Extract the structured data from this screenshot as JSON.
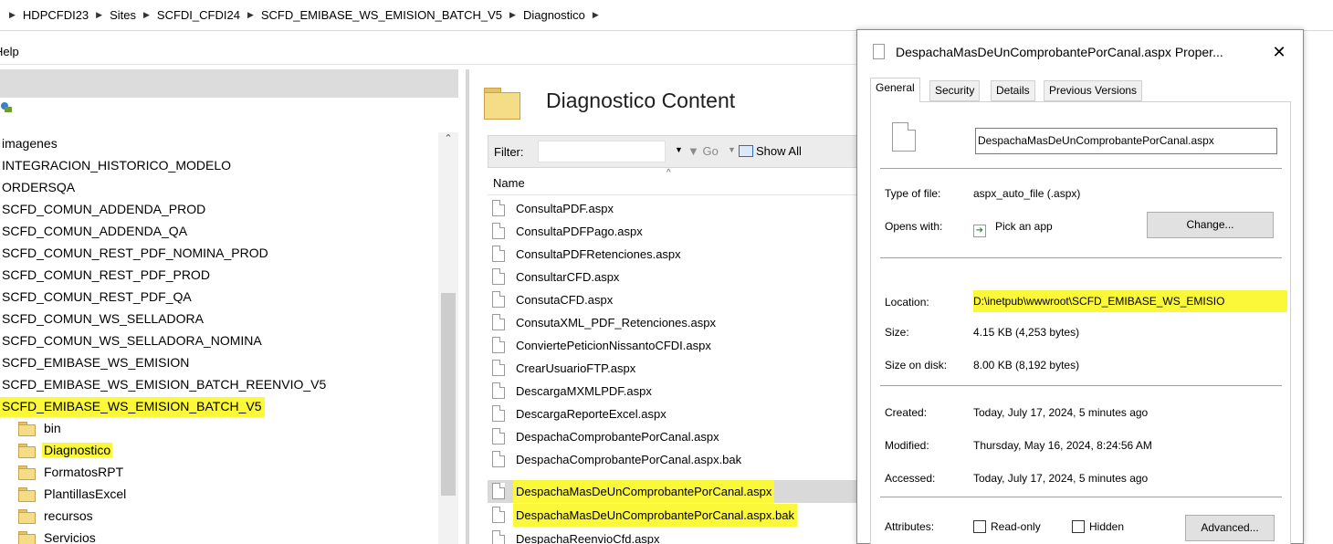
{
  "breadcrumb": [
    "HDPCFDI23",
    "Sites",
    "SCFDI_CFDI24",
    "SCFD_EMIBASE_WS_EMISION_BATCH_V5",
    "Diagnostico"
  ],
  "menu": {
    "help": "Help"
  },
  "tree": {
    "items": [
      "imagenes",
      "INTEGRACION_HISTORICO_MODELO",
      "ORDERSQA",
      "SCFD_COMUN_ADDENDA_PROD",
      "SCFD_COMUN_ADDENDA_QA",
      "SCFD_COMUN_REST_PDF_NOMINA_PROD",
      "SCFD_COMUN_REST_PDF_PROD",
      "SCFD_COMUN_REST_PDF_QA",
      "SCFD_COMUN_WS_SELLADORA",
      "SCFD_COMUN_WS_SELLADORA_NOMINA",
      "SCFD_EMIBASE_WS_EMISION",
      "SCFD_EMIBASE_WS_EMISION_BATCH_REENVIO_V5",
      "SCFD_EMIBASE_WS_EMISION_BATCH_V5"
    ],
    "subfolders": [
      "bin",
      "Diagnostico",
      "FormatosRPT",
      "PlantillasExcel",
      "recursos",
      "Servicios"
    ]
  },
  "content": {
    "title": "Diagnostico Content",
    "filter_label": "Filter:",
    "go_label": "Go",
    "show_all_label": "Show All",
    "column_name": "Name",
    "files": [
      "ConsultaPDF.aspx",
      "ConsultaPDFPago.aspx",
      "ConsultaPDFRetenciones.aspx",
      "ConsultarCFD.aspx",
      "ConsutaCFD.aspx",
      "ConsutaXML_PDF_Retenciones.aspx",
      "ConviertePeticionNissantoCFDI.aspx",
      "CrearUsuarioFTP.aspx",
      "DescargaMXMLPDF.aspx",
      "DescargaReporteExcel.aspx",
      "DespachaComprobantePorCanal.aspx",
      "DespachaComprobantePorCanal.aspx.bak",
      "DespachaMasDeUnComprobantePorCanal.aspx",
      "DespachaMasDeUnComprobantePorCanal.aspx.bak",
      "DespachaReenvioCfd.aspx"
    ]
  },
  "dialog": {
    "title": "DespachaMasDeUnComprobantePorCanal.aspx Proper...",
    "tabs": [
      "General",
      "Security",
      "Details",
      "Previous Versions"
    ],
    "file_name": "DespachaMasDeUnComprobantePorCanal.aspx",
    "type_label": "Type of file:",
    "type_value": "aspx_auto_file (.aspx)",
    "opens_label": "Opens with:",
    "opens_value": "Pick an app",
    "change_button": "Change...",
    "location_label": "Location:",
    "location_value": "D:\\inetpub\\wwwroot\\SCFD_EMIBASE_WS_EMISIO",
    "size_label": "Size:",
    "size_value": "4.15 KB (4,253 bytes)",
    "size_disk_label": "Size on disk:",
    "size_disk_value": "8.00 KB (8,192 bytes)",
    "created_label": "Created:",
    "created_value": "Today, July 17, 2024, 5 minutes ago",
    "modified_label": "Modified:",
    "modified_value": "Thursday, May 16, 2024, 8:24:56 AM",
    "accessed_label": "Accessed:",
    "accessed_value": "Today, July 17, 2024, 5 minutes ago",
    "attributes_label": "Attributes:",
    "readonly_label": "Read-only",
    "hidden_label": "Hidden",
    "advanced_button": "Advanced...",
    "close_glyph": "✕"
  },
  "colors": {
    "highlight": "#fbf83a",
    "folder": "#f5dc87"
  }
}
